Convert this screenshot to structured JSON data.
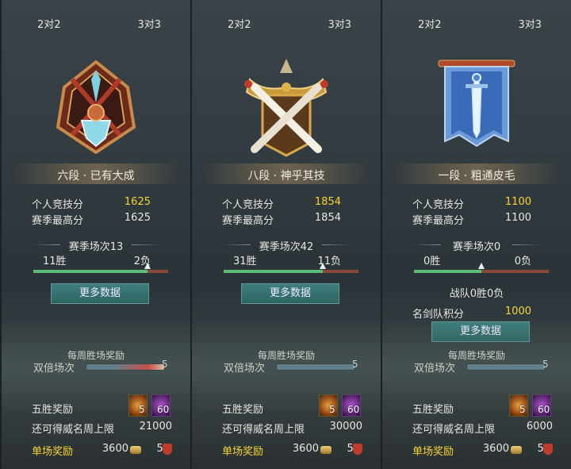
{
  "panels": [
    {
      "tabs": [
        "2对2",
        "3对3"
      ],
      "rank_title": "六段 · 已有大成",
      "personal_score_label": "个人竞技分",
      "personal_score": "1625",
      "season_high_label": "赛季最高分",
      "season_high": "1625",
      "season_matches": "赛季场次13",
      "wins": "11胜",
      "losses": "2负",
      "win_fraction": 0.846,
      "more_data": "更多数据",
      "weekly_reward": "每周胜场奖励",
      "double_label": "双倍场次",
      "double_count": "5",
      "five_win_label": "五胜奖励",
      "item_chest_count": "5",
      "item_gem_count": "60",
      "remaining_label": "还可得威名周上限",
      "remaining_value": "21000",
      "single_reward_label": "单场奖励",
      "single_coin": "3600",
      "single_shield": "50"
    },
    {
      "tabs": [
        "2对2",
        "3对3"
      ],
      "rank_title": "八段 · 神乎其技",
      "personal_score_label": "个人竞技分",
      "personal_score": "1854",
      "season_high_label": "赛季最高分",
      "season_high": "1854",
      "season_matches": "赛季场次42",
      "wins": "31胜",
      "losses": "11负",
      "win_fraction": 0.738,
      "more_data": "更多数据",
      "weekly_reward": "每周胜场奖励",
      "double_label": "双倍场次",
      "double_count": "5",
      "five_win_label": "五胜奖励",
      "item_chest_count": "5",
      "item_gem_count": "60",
      "remaining_label": "还可得威名周上限",
      "remaining_value": "30000",
      "single_reward_label": "单场奖励",
      "single_coin": "3600",
      "single_shield": "50"
    },
    {
      "tabs": [
        "2对2",
        "3对3"
      ],
      "rank_title": "一段 · 粗通皮毛",
      "personal_score_label": "个人竞技分",
      "personal_score": "1100",
      "season_high_label": "赛季最高分",
      "season_high": "1100",
      "season_matches": "赛季场次0",
      "wins": "0胜",
      "losses": "0负",
      "win_fraction": 0.5,
      "team_record": "战队0胜0负",
      "team_score_label": "名剑队积分",
      "team_score": "1000",
      "more_data": "更多数据",
      "weekly_reward": "每周胜场奖励",
      "double_label": "双倍场次",
      "double_count": "5",
      "five_win_label": "五胜奖励",
      "item_chest_count": "5",
      "item_gem_count": "60",
      "remaining_label": "还可得威名周上限",
      "remaining_value": "6000",
      "single_reward_label": "单场奖励",
      "single_coin": "3600",
      "single_shield": "50"
    }
  ],
  "icons": {
    "emblem_1": "crossed-blades-crest-icon",
    "emblem_2": "crossed-swords-gold-crest-icon",
    "emblem_3": "blue-banner-sword-icon",
    "chest": "treasure-chest-icon",
    "gem": "purple-gem-icon",
    "coin": "coin-icon",
    "shield": "shield-icon"
  },
  "colors": {
    "highlight": "#f5d631",
    "button": "#2d6462",
    "win_bar": "#5cbc7a",
    "loss_bar": "#8a4a3a"
  }
}
